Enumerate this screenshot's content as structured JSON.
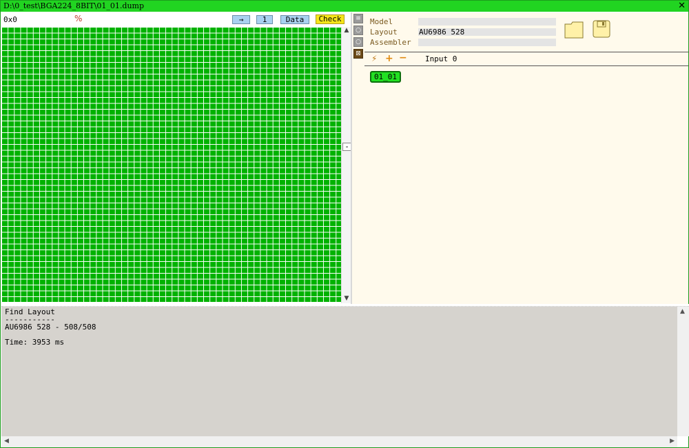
{
  "window": {
    "title": "D:\\0_test\\BGA224_8BIT\\01_01.dump",
    "close_glyph": "✕"
  },
  "left_panel": {
    "address_value": "0x0",
    "percent_icon": "%",
    "toolbar": {
      "arrow_label": "→",
      "count_label": "1",
      "data_label": "Data",
      "check_label": "Check"
    },
    "grid_fill_color": "#00b200",
    "scrollbar": {
      "up_glyph": "▲",
      "down_glyph": "▼",
      "minus_label": "-"
    }
  },
  "right_panel": {
    "side_icons": [
      "list-icon",
      "bulb-icon",
      "bulb-icon",
      "map-icon"
    ],
    "fields": {
      "model_label": "Model",
      "model_value": "",
      "layout_label": "Layout",
      "layout_value": "AU6986 528",
      "assembler_label": "Assembler",
      "assembler_value": ""
    },
    "tools": {
      "lightning": "⚡",
      "plus": "+",
      "minus": "−",
      "input_label": "Input 0"
    },
    "chip_label": "01_01"
  },
  "console": {
    "lines": [
      "Find Layout",
      "-----------",
      "AU6986 528 - 508/508",
      "",
      "Time: 3953 ms"
    ],
    "background": "#d6d3ce"
  },
  "colors": {
    "title_bar": "#21d421",
    "grid": "#00b200",
    "chip": "#22e022",
    "right_bg": "#fffaec"
  }
}
